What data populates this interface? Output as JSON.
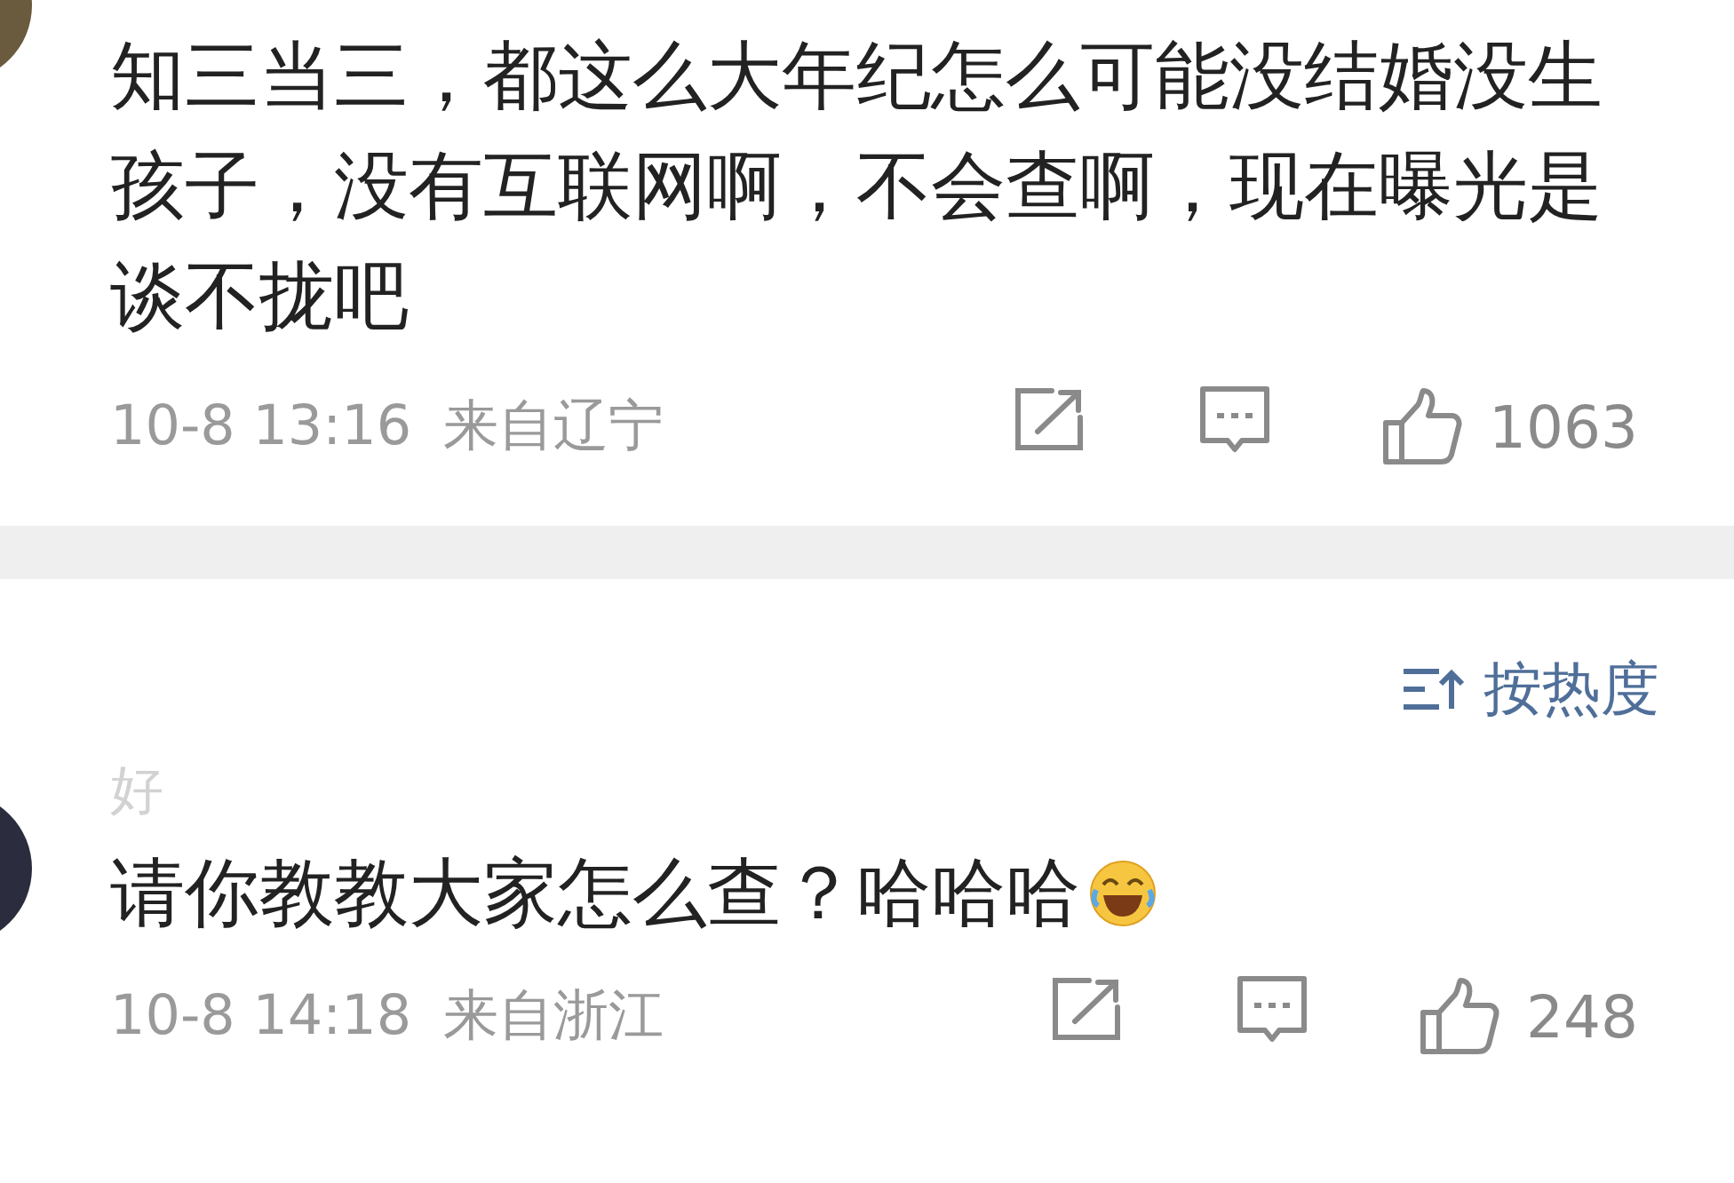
{
  "sort": {
    "label": "按热度"
  },
  "comments": [
    {
      "text": "知三当三，都这么大年纪怎么可能没结婚没生孩子，没有互联网啊，不会查啊，现在曝光是谈不拢吧",
      "emoji": false,
      "time": "10-8 13:16",
      "location": "来自辽宁",
      "likes": "1063"
    },
    {
      "username": "好",
      "text": "请你教教大家怎么查？哈哈哈",
      "emoji": true,
      "time": "10-8 14:18",
      "location": "来自浙江",
      "likes": "248"
    }
  ]
}
